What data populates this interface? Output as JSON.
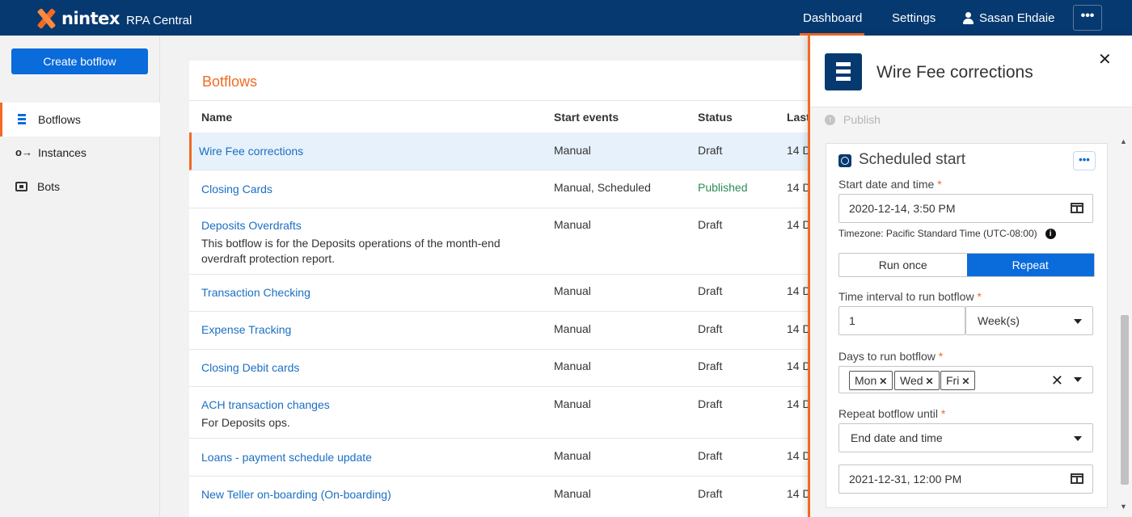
{
  "header": {
    "brand": "nintex",
    "app_name": "RPA Central",
    "nav": {
      "dashboard": "Dashboard",
      "settings": "Settings",
      "user": "Sasan Ehdaie",
      "more": "•••"
    },
    "accent_color": "#f26a24",
    "bar_color": "#063970"
  },
  "sidebar": {
    "create_label": "Create botflow",
    "items": [
      {
        "label": "Botflows",
        "icon": "botflows-icon",
        "active": true
      },
      {
        "label": "Instances",
        "icon": "instances-icon",
        "active": false
      },
      {
        "label": "Bots",
        "icon": "bots-icon",
        "active": false
      }
    ]
  },
  "main": {
    "title": "Botflows",
    "columns": {
      "name": "Name",
      "start_events": "Start events",
      "status": "Status",
      "last": "Last"
    },
    "rows": [
      {
        "name": "Wire Fee corrections",
        "desc": "",
        "events": "Manual",
        "status": "Draft",
        "last": "14 D"
      },
      {
        "name": "Closing Cards",
        "desc": "",
        "events": "Manual, Scheduled",
        "status": "Published",
        "last": "14 D"
      },
      {
        "name": "Deposits Overdrafts",
        "desc": "This botflow is for the Deposits operations of the month-end overdraft protection report.",
        "events": "Manual",
        "status": "Draft",
        "last": "14 D"
      },
      {
        "name": "Transaction Checking",
        "desc": "",
        "events": "Manual",
        "status": "Draft",
        "last": "14 D"
      },
      {
        "name": "Expense Tracking",
        "desc": "",
        "events": "Manual",
        "status": "Draft",
        "last": "14 D"
      },
      {
        "name": "Closing Debit cards",
        "desc": "",
        "events": "Manual",
        "status": "Draft",
        "last": "14 D"
      },
      {
        "name": "ACH transaction changes",
        "desc": "For Deposits ops.",
        "events": "Manual",
        "status": "Draft",
        "last": "14 D"
      },
      {
        "name": "Loans - payment schedule update",
        "desc": "",
        "events": "Manual",
        "status": "Draft",
        "last": "14 D"
      },
      {
        "name": "New Teller on-boarding (On-boarding)",
        "desc": "",
        "events": "Manual",
        "status": "Draft",
        "last": "14 D"
      }
    ]
  },
  "panel": {
    "title": "Wire Fee corrections",
    "close": "✕",
    "publish_label": "Publish",
    "schedule": {
      "title": "Scheduled start",
      "more": "•••",
      "start_label": "Start date and time",
      "required_mark": "*",
      "start_value": "2020-12-14, 3:50 PM",
      "timezone": "Timezone: Pacific Standard Time (UTC-08:00)",
      "run_once": "Run once",
      "repeat": "Repeat",
      "interval_label": "Time interval to run botflow",
      "interval_value": "1",
      "interval_unit": "Week(s)",
      "days_label": "Days to run botflow",
      "days": [
        "Mon",
        "Wed",
        "Fri"
      ],
      "until_label": "Repeat botflow until",
      "until_value": "End date and time",
      "end_value": "2021-12-31, 12:00 PM"
    }
  }
}
